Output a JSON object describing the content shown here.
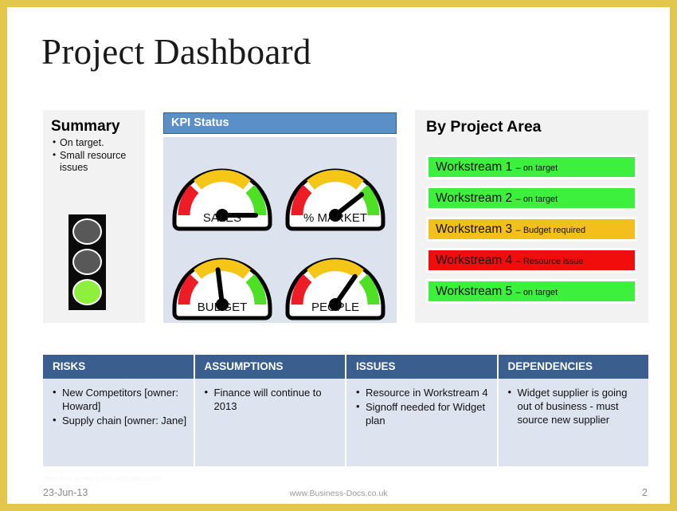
{
  "slide": {
    "title": "Project Dashboard",
    "border_color": "#e3c74d"
  },
  "summary": {
    "heading": "Summary",
    "bullets": [
      "On target.",
      "Small  resource issues"
    ],
    "traffic_light": {
      "red": {
        "state": "off",
        "color": "#585858"
      },
      "amber": {
        "state": "off",
        "color": "#585858"
      },
      "green": {
        "state": "on",
        "color": "#8ef03c"
      }
    }
  },
  "kpi": {
    "header": "KPI Status",
    "header_color": "#5b8fc7",
    "body_color": "#dde2ef",
    "gauges": [
      {
        "label": "SALES",
        "needle_angle_deg": 0,
        "zone": "green"
      },
      {
        "label": "% MARKET",
        "needle_angle_deg": 38,
        "zone": "green"
      },
      {
        "label": "BUDGET",
        "needle_angle_deg": 97,
        "zone": "amber"
      },
      {
        "label": "PEOPLE",
        "needle_angle_deg": 55,
        "zone": "amber"
      }
    ],
    "zone_colors": {
      "red": "#ee1c25",
      "amber": "#f5c518",
      "green": "#4ee024"
    }
  },
  "project_area": {
    "heading": "By Project Area",
    "workstreams": [
      {
        "name": "Workstream 1",
        "status": "– on target",
        "color": "#3ef03e"
      },
      {
        "name": "Workstream 2",
        "status": "– on target",
        "color": "#3ef03e"
      },
      {
        "name": "Workstream 3",
        "status": "– Budget  required",
        "color": "#f2bf1d"
      },
      {
        "name": "Workstream 4",
        "status": "– Resource  issue",
        "color": "#f20d0d"
      },
      {
        "name": "Workstream 5",
        "status": "– on target",
        "color": "#3ef03e"
      }
    ]
  },
  "table": {
    "header_color": "#3a5f8f",
    "columns": [
      {
        "header": "RISKS",
        "items": [
          "New Competitors [owner: Howard]",
          "Supply chain [owner: Jane]"
        ]
      },
      {
        "header": "ASSUMPTIONS",
        "items": [
          "Finance  will continue to 2013"
        ]
      },
      {
        "header": "ISSUES",
        "items": [
          "Resource in Workstream 4",
          "Signoff needed for Widget plan"
        ]
      },
      {
        "header": "DEPENDENCIES",
        "items": [
          "Widget supplier is going out of business - must source new supplier"
        ]
      }
    ]
  },
  "footer": {
    "watermark": "www.free-power-point-templates.com",
    "date": "23-Jun-13",
    "url": "www.Business-Docs.co.uk",
    "page": "2"
  }
}
